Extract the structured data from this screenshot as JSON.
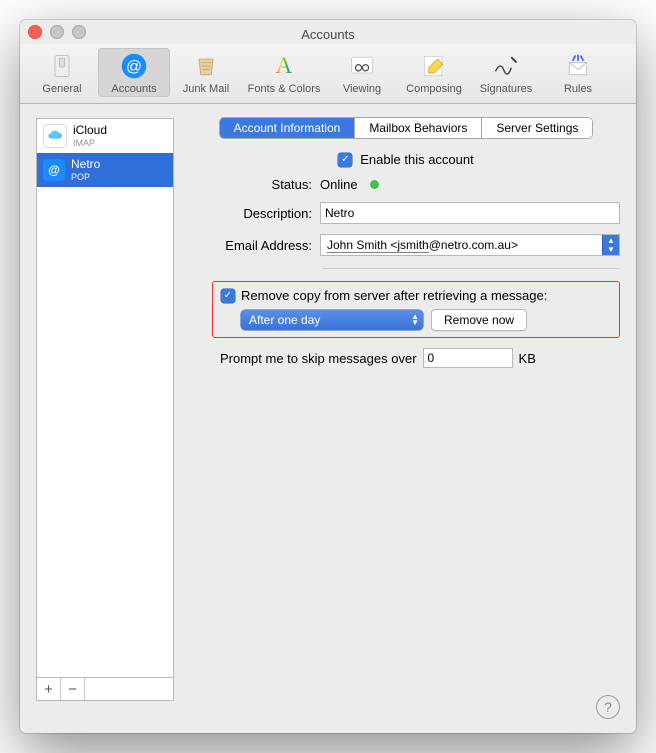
{
  "window": {
    "title": "Accounts"
  },
  "toolbar": {
    "items": [
      {
        "label": "General"
      },
      {
        "label": "Accounts"
      },
      {
        "label": "Junk Mail"
      },
      {
        "label": "Fonts & Colors"
      },
      {
        "label": "Viewing"
      },
      {
        "label": "Composing"
      },
      {
        "label": "Signatures"
      },
      {
        "label": "Rules"
      }
    ],
    "selected_index": 1
  },
  "sidebar": {
    "accounts": [
      {
        "name": "iCloud",
        "type": "IMAP",
        "icon": "cloud"
      },
      {
        "name": "Netro",
        "type": "POP",
        "icon": "at"
      }
    ],
    "selected_index": 1,
    "add_label": "+",
    "remove_label": "−"
  },
  "main": {
    "tabs": [
      {
        "label": "Account Information"
      },
      {
        "label": "Mailbox Behaviors"
      },
      {
        "label": "Server Settings"
      }
    ],
    "active_tab": 0,
    "enable_label": "Enable this account",
    "enable_checked": true,
    "status_label": "Status:",
    "status_value": "Online",
    "description_label": "Description:",
    "description_value": "Netro",
    "email_label": "Email Address:",
    "email_name": "John Smith <jsmith",
    "email_domain": "@netro.com.au>",
    "remove_copy_label": "Remove copy from server after retrieving a message:",
    "remove_copy_checked": true,
    "remove_after_value": "After one day",
    "remove_now_label": "Remove now",
    "skip_label": "Prompt me to skip messages over",
    "skip_value": "0",
    "skip_unit": "KB"
  },
  "help_label": "?"
}
